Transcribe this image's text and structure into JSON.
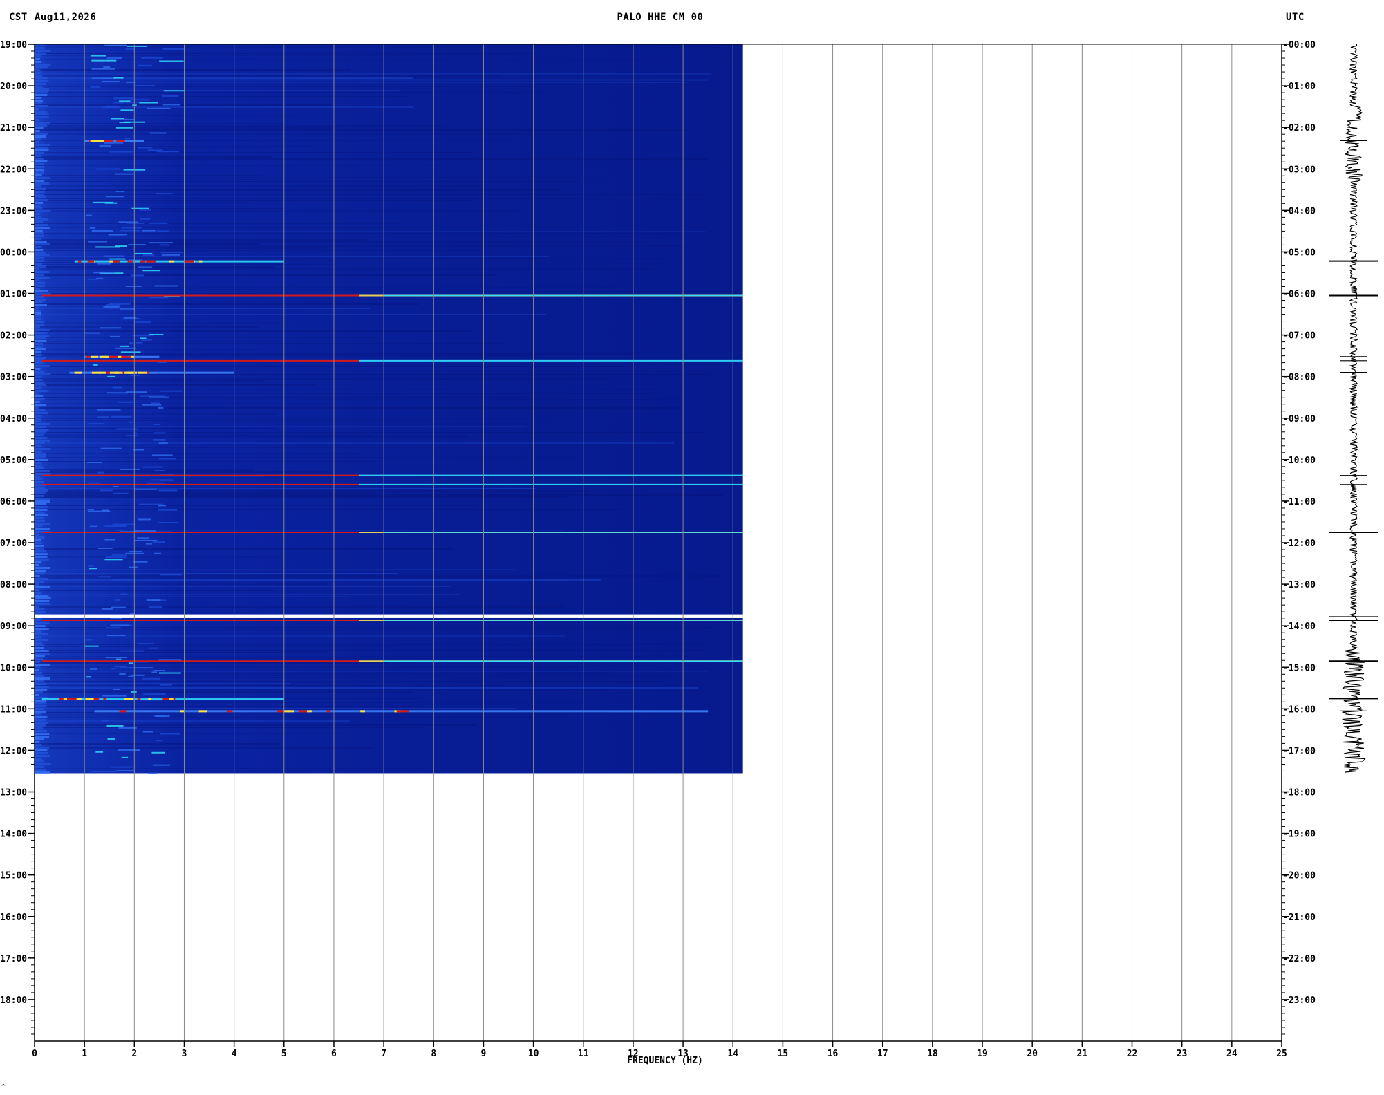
{
  "header": {
    "left_timezone": "CST",
    "date": "Aug11,2026",
    "title": "PALO HHE CM 00",
    "right_timezone": "UTC"
  },
  "footnote": "^",
  "colors": {
    "background": "#ffffff",
    "spectrogram_base": "#0a1f9e",
    "spectrogram_dark": "#06127a",
    "spectrogram_mid": "#1f4fd8",
    "cyan": "#33e0ff",
    "yellow": "#ffe14a",
    "red": "#d21a1a",
    "gridline": "#8a8a8a",
    "trace": "#000000"
  },
  "chart_data": {
    "type": "heatmap",
    "title": "PALO HHE CM 00",
    "xlabel": "FREQUENCY (HZ)",
    "ylabel": "",
    "xlim": [
      0,
      25
    ],
    "x_ticks": [
      "0",
      "1",
      "2",
      "3",
      "4",
      "5",
      "6",
      "7",
      "8",
      "9",
      "10",
      "11",
      "12",
      "13",
      "14",
      "15",
      "16",
      "17",
      "18",
      "19",
      "20",
      "21",
      "22",
      "23",
      "24",
      "25"
    ],
    "y_left_labels": [
      "19:00",
      "20:00",
      "21:00",
      "22:00",
      "23:00",
      "00:00",
      "01:00",
      "02:00",
      "03:00",
      "04:00",
      "05:00",
      "06:00",
      "07:00",
      "08:00",
      "09:00",
      "10:00",
      "11:00",
      "12:00",
      "13:00",
      "14:00",
      "15:00",
      "16:00",
      "17:00",
      "18:00"
    ],
    "y_right_labels": [
      "00:00",
      "01:00",
      "02:00",
      "03:00",
      "04:00",
      "05:00",
      "06:00",
      "07:00",
      "08:00",
      "09:00",
      "10:00",
      "11:00",
      "12:00",
      "13:00",
      "14:00",
      "15:00",
      "16:00",
      "17:00",
      "18:00",
      "19:00",
      "20:00",
      "21:00",
      "22:00",
      "23:00"
    ],
    "ylim_hours": [
      0,
      24
    ],
    "data_extent": {
      "frequency_max_hz": 14.2,
      "hours_recorded": 17.55
    },
    "horizontal_lines": [
      {
        "hour": 6.05,
        "f_start": 0.15,
        "f_end": 14.2,
        "strength": "high"
      },
      {
        "hour": 7.62,
        "f_start": 0.15,
        "f_end": 14.2,
        "strength": "medium"
      },
      {
        "hour": 10.38,
        "f_start": 0.15,
        "f_end": 14.2,
        "strength": "medium"
      },
      {
        "hour": 10.6,
        "f_start": 0.15,
        "f_end": 14.2,
        "strength": "medium"
      },
      {
        "hour": 11.75,
        "f_start": 0.15,
        "f_end": 14.2,
        "strength": "high"
      },
      {
        "hour": 13.78,
        "f_start": 0.0,
        "f_end": 14.2,
        "strength": "white"
      },
      {
        "hour": 13.88,
        "f_start": 0.15,
        "f_end": 14.2,
        "strength": "high"
      },
      {
        "hour": 14.85,
        "f_start": 0.15,
        "f_end": 14.2,
        "strength": "high"
      }
    ],
    "bursts": [
      {
        "hour": 5.22,
        "f_start": 0.8,
        "f_end": 5.0,
        "strength": "high"
      },
      {
        "hour": 7.52,
        "f_start": 1.0,
        "f_end": 2.5,
        "strength": "medium"
      },
      {
        "hour": 7.9,
        "f_start": 0.7,
        "f_end": 4.0,
        "strength": "medium"
      },
      {
        "hour": 15.75,
        "f_start": 0.15,
        "f_end": 5.0,
        "strength": "high"
      },
      {
        "hour": 16.05,
        "f_start": 1.2,
        "f_end": 13.5,
        "strength": "medium"
      },
      {
        "hour": 2.32,
        "f_start": 1.0,
        "f_end": 2.2,
        "strength": "medium"
      }
    ],
    "grid": true
  }
}
